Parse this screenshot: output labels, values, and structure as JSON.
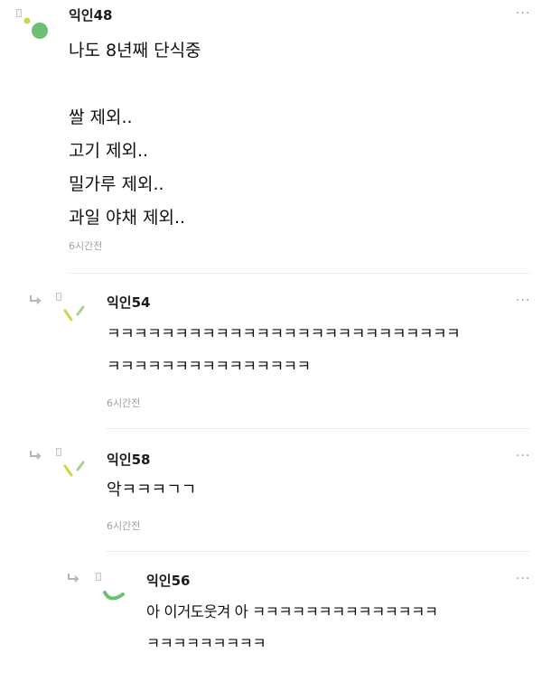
{
  "comments": [
    {
      "author": "익인48",
      "body": "나도 8년째 단식중\n\n쌀 제외..\n고기 제외..\n밀가루 제외..\n과일 야채 제외..",
      "time": "6시간전",
      "more": "···",
      "is_reply": false
    },
    {
      "author": "익인54",
      "body": "ㅋㅋㅋㅋㅋㅋㅋㅋㅋㅋㅋㅋㅋㅋㅋㅋㅋㅋㅋㅋㅋㅋㅋㅋㅋㅋ\nㅋㅋㅋㅋㅋㅋㅋㅋㅋㅋㅋㅋㅋㅋㅋ",
      "time": "6시간전",
      "more": "···",
      "is_reply": true
    },
    {
      "author": "익인58",
      "body": "악ㅋㅋㅋㄱㄱ",
      "time": "6시간전",
      "more": "···",
      "is_reply": true
    },
    {
      "author": "익인56",
      "body": "아 이거도웃겨 아 ㅋㅋㅋㅋㅋㅋㅋㅋㅋㅋㅋㅋㅋㅋ\nㅋㅋㅋㅋㅋㅋㅋㅋㅋ",
      "time": "",
      "more": "···",
      "is_reply": true
    }
  ],
  "colors": {
    "avatar_green": "#6cbf74",
    "avatar_lime": "#c7d94c",
    "avatar_sage": "#a9d18e",
    "arrow_gray": "#b5b5b5",
    "divider": "#ececec",
    "time_gray": "#a0a0a0"
  },
  "icons": {
    "reply": "reply-arrow-icon",
    "more": "more-options-icon"
  }
}
